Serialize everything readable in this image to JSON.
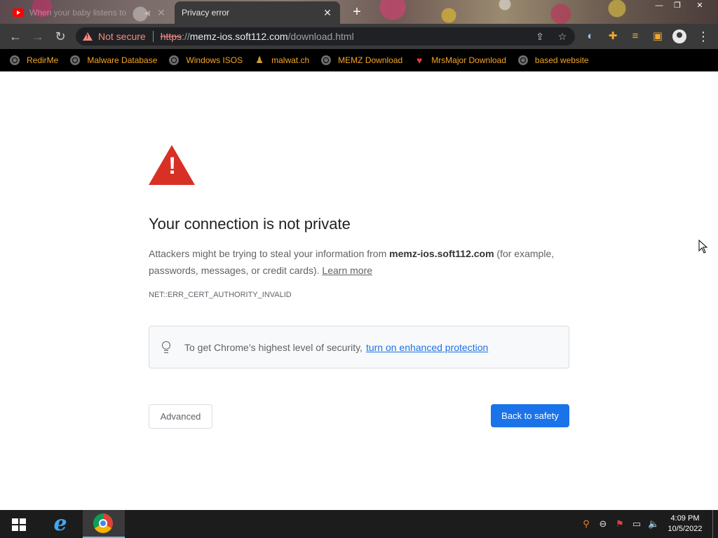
{
  "browser": {
    "tabs": [
      {
        "title": "When your baby listens to",
        "active": false
      },
      {
        "title": "Privacy error",
        "active": true
      }
    ],
    "address": {
      "security_label": "Not secure",
      "url_scheme": "https",
      "url_separator": "://",
      "url_host": "memz-ios.soft112.com",
      "url_path": "/download.html"
    },
    "bookmarks": [
      {
        "label": "RedirMe",
        "icon": "globe-icon"
      },
      {
        "label": "Malware Database",
        "icon": "globe-icon"
      },
      {
        "label": "Windows ISOS",
        "icon": "globe-icon"
      },
      {
        "label": "malwat.ch",
        "icon": "person-icon"
      },
      {
        "label": "MEMZ Download",
        "icon": "globe-icon"
      },
      {
        "label": "MrsMajor Download",
        "icon": "heart-icon"
      },
      {
        "label": "based website",
        "icon": "globe-icon"
      }
    ]
  },
  "error_page": {
    "heading": "Your connection is not private",
    "body_prefix": "Attackers might be trying to steal your information from ",
    "body_host": "memz-ios.soft112.com",
    "body_suffix": " (for example, passwords, messages, or credit cards). ",
    "learn_more": "Learn more",
    "error_code": "NET::ERR_CERT_AUTHORITY_INVALID",
    "info_text": "To get Chrome’s highest level of security,",
    "info_link": "turn on enhanced protection",
    "advanced_label": "Advanced",
    "back_label": "Back to safety"
  },
  "taskbar": {
    "time": "4:09 PM",
    "date": "10/5/2022"
  },
  "colors": {
    "warning_red": "#d93025",
    "link_blue": "#1a73e8",
    "not_secure": "#f28b82",
    "bookmark_text": "#f5a623",
    "toolbar_bg": "#3a3a3a"
  }
}
